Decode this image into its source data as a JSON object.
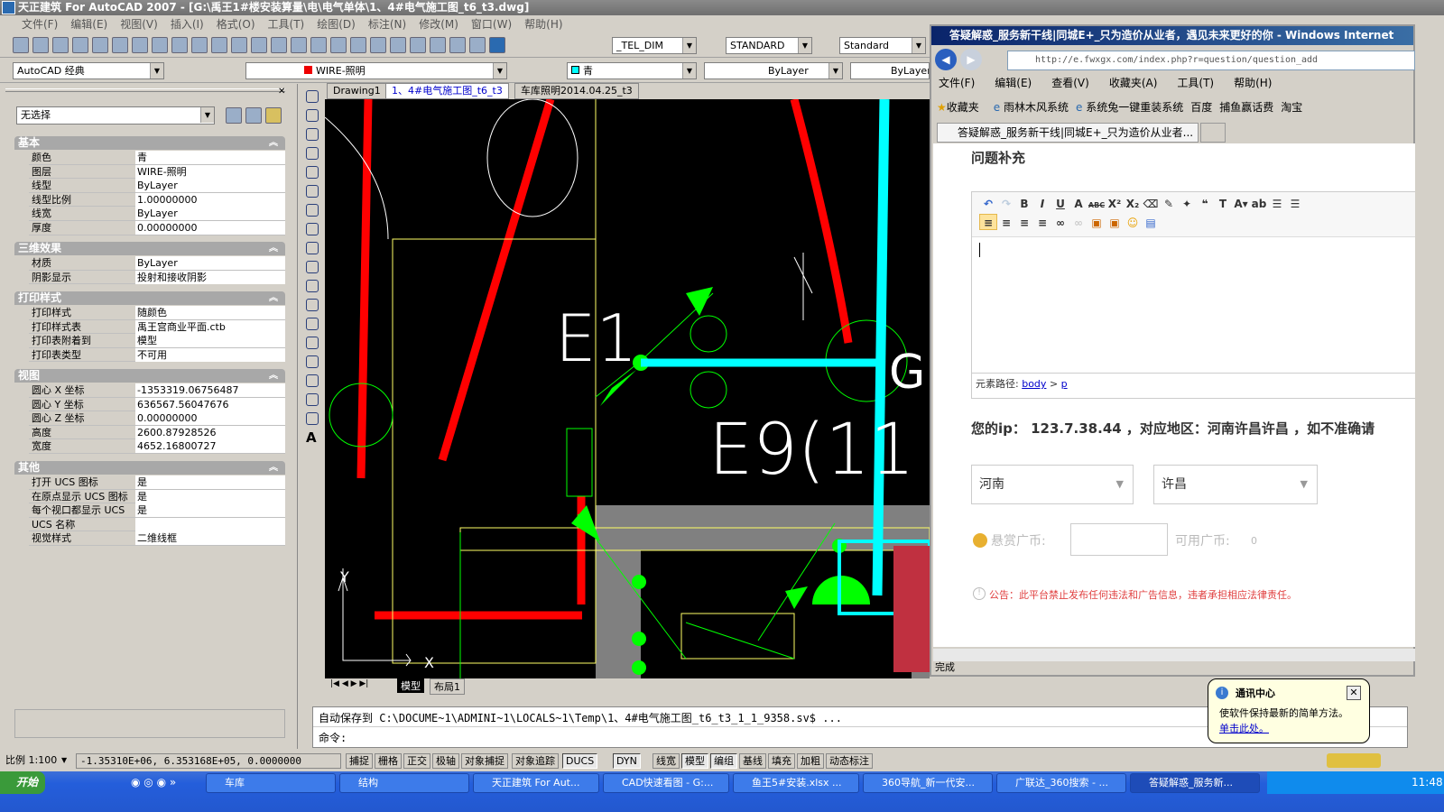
{
  "window": {
    "title": "天正建筑 For AutoCAD 2007 - [G:\\禹王1#楼安装算量\\电\\电气单体\\1、4#电气施工图_t6_t3.dwg]"
  },
  "menu": [
    "文件(F)",
    "编辑(E)",
    "视图(V)",
    "插入(I)",
    "格式(O)",
    "工具(T)",
    "绘图(D)",
    "标注(N)",
    "修改(M)",
    "窗口(W)",
    "帮助(H)"
  ],
  "toolbar": {
    "text_style": "_TEL_DIM",
    "dim_style": "STANDARD",
    "table_style": "Standard",
    "workspace": "AutoCAD 经典",
    "layer": "WIRE-照明",
    "color": "青",
    "linetype": "ByLayer",
    "lineweight": "ByLayer"
  },
  "properties": {
    "selection": "无选择",
    "sections": [
      {
        "title": "基本",
        "rows": [
          [
            "颜色",
            "青"
          ],
          [
            "图层",
            "WIRE-照明"
          ],
          [
            "线型",
            "ByLayer"
          ],
          [
            "线型比例",
            "1.00000000"
          ],
          [
            "线宽",
            "ByLayer"
          ],
          [
            "厚度",
            "0.00000000"
          ]
        ]
      },
      {
        "title": "三维效果",
        "rows": [
          [
            "材质",
            "ByLayer"
          ],
          [
            "阴影显示",
            "投射和接收阴影"
          ]
        ]
      },
      {
        "title": "打印样式",
        "rows": [
          [
            "打印样式",
            "随颜色"
          ],
          [
            "打印样式表",
            "禹王宫商业平面.ctb"
          ],
          [
            "打印表附着到",
            "模型"
          ],
          [
            "打印表类型",
            "不可用"
          ]
        ]
      },
      {
        "title": "视图",
        "rows": [
          [
            "圆心 X 坐标",
            "-1353319.06756487"
          ],
          [
            "圆心 Y 坐标",
            "636567.56047676"
          ],
          [
            "圆心 Z 坐标",
            "0.00000000"
          ],
          [
            "高度",
            "2600.87928526"
          ],
          [
            "宽度",
            "4652.16800727"
          ]
        ]
      },
      {
        "title": "其他",
        "rows": [
          [
            "打开 UCS 图标",
            "是"
          ],
          [
            "在原点显示 UCS 图标",
            "是"
          ],
          [
            "每个视口都显示 UCS",
            "是"
          ],
          [
            "UCS 名称",
            ""
          ],
          [
            "视觉样式",
            "二维线框"
          ]
        ]
      }
    ]
  },
  "doc_tabs": [
    "Drawing1",
    "1、4#电气施工图_t6_t3",
    "车库照明2014.04.25_t3"
  ],
  "canvas_labels": {
    "e1": "E1",
    "e9": "E9(11",
    "g": "G",
    "ucs_x": "X",
    "ucs_y": "Y"
  },
  "layout_tabs": [
    "模型",
    "布局1"
  ],
  "command": {
    "history": "自动保存到 C:\\DOCUME~1\\ADMINI~1\\LOCALS~1\\Temp\\1、4#电气施工图_t6_t3_1_1_9358.sv$ ...",
    "prompt": "命令:"
  },
  "status": {
    "scale": "比例 1:100",
    "coords": "-1.35310E+06, 6.353168E+05, 0.0000000",
    "toggles": [
      {
        "label": "捕捉",
        "on": false
      },
      {
        "label": "栅格",
        "on": false
      },
      {
        "label": "正交",
        "on": false
      },
      {
        "label": "极轴",
        "on": false
      },
      {
        "label": "对象捕捉",
        "on": false
      },
      {
        "label": "对象追踪",
        "on": false
      },
      {
        "label": "DUCS",
        "on": true
      },
      {
        "label": "DYN",
        "on": true
      },
      {
        "label": "线宽",
        "on": false
      },
      {
        "label": "模型",
        "on": true
      },
      {
        "label": "编组",
        "on": true
      },
      {
        "label": "基线",
        "on": false
      },
      {
        "label": "填充",
        "on": false
      },
      {
        "label": "加粗",
        "on": false
      },
      {
        "label": "动态标注",
        "on": false
      }
    ]
  },
  "taskbar": {
    "start": "开始",
    "items": [
      "车库",
      "结构",
      "天正建筑 For Aut...",
      "CAD快速看图 - G:...",
      "鱼王5#安装.xlsx ...",
      "360导航_新一代安...",
      "广联达_360搜索 - ...",
      "答疑解惑_服务新..."
    ],
    "clock": "11:48"
  },
  "balloon": {
    "title": "通讯中心",
    "text": "使软件保持最新的简单方法。",
    "link": "单击此处。"
  },
  "ie": {
    "title": "答疑解惑_服务新干线|同城E+_只为造价从业者，遇见未来更好的你 - Windows Internet",
    "url": "http://e.fwxgx.com/index.php?r=question/question_add",
    "menu": [
      "文件(F)",
      "编辑(E)",
      "查看(V)",
      "收藏夹(A)",
      "工具(T)",
      "帮助(H)"
    ],
    "favorites": [
      "收藏夹",
      "雨林木风系统",
      "系统兔一键重装系统",
      "百度",
      "捕鱼赢话费",
      "淘宝"
    ],
    "tab": "答疑解惑_服务新干线|同城E+_只为造价从业者...",
    "heading": "问题补充",
    "element_path_label": "元素路径:",
    "path_body": "body",
    "path_sep": ">",
    "path_p": "p",
    "ip_text": "您的ip： 123.7.38.44 ，对应地区：河南许昌许昌 ，如不准确请",
    "province": "河南",
    "city": "许昌",
    "reward_label": "悬赏广币:",
    "available_label": "可用广币:",
    "available_value": "0",
    "notice": "公告：此平台禁止发布任何违法和广告信息，违者承担相应法律责任。",
    "status": "完成"
  }
}
